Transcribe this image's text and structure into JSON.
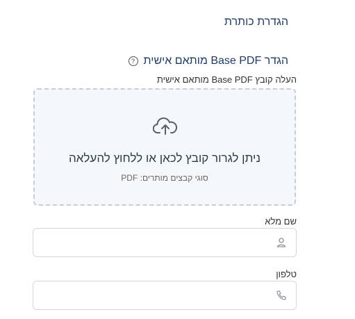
{
  "header_settings": {
    "title": "הגדרת כותרת"
  },
  "custom_pdf": {
    "title": "הגדר Base PDF מותאם אישית",
    "help_glyph": "?",
    "upload_label": "העלה קובץ Base PDF מותאם אישית",
    "dropzone_title": "ניתן לגרור קובץ לכאן או ללחוץ להעלאה",
    "dropzone_hint": "סוגי קבצים מותרים: PDF"
  },
  "fields": {
    "full_name": {
      "label": "שם מלא",
      "value": "",
      "placeholder": "",
      "icon": "user-icon"
    },
    "phone": {
      "label": "טלפון",
      "value": "",
      "placeholder": "",
      "icon": "phone-icon"
    }
  },
  "colors": {
    "accent_text": "#1e3a5f",
    "dropzone_bg": "#f5f8fa",
    "border": "#d3d7dc"
  }
}
